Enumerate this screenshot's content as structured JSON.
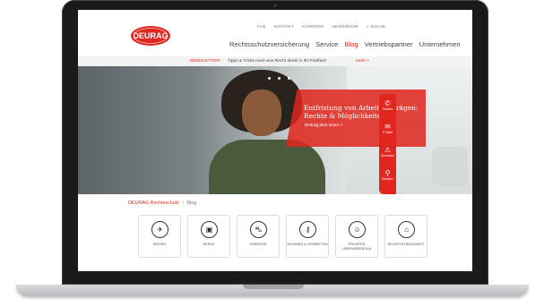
{
  "header": {
    "logo_text": "DEURAG",
    "top_nav": [
      "FAQ",
      "KONTAKT",
      "KARRIERE",
      "NEWSROOM"
    ],
    "search_label": "SUCHE",
    "main_nav": [
      {
        "label": "Rechtsschutzversicherung",
        "active": false
      },
      {
        "label": "Service",
        "active": false
      },
      {
        "label": "Blog",
        "active": true
      },
      {
        "label": "Vertriebspartner",
        "active": false
      },
      {
        "label": "Unternehmen",
        "active": false
      }
    ]
  },
  "newsletter": {
    "label": "NEWSLETTER:",
    "text": "Tipps & Tricks rund ums Recht direkt in Ihr Postfach",
    "more": "mehr >"
  },
  "hero": {
    "title": "Entfristung von Arbeitsverträgen: Rechte & Möglichkeiten",
    "cta": "Beitrag jetzt lesen  >"
  },
  "sidebar": {
    "items": [
      {
        "icon": "phone-icon",
        "glyph": "✆",
        "label": "Telefon"
      },
      {
        "icon": "mail-icon",
        "glyph": "✉",
        "label": "E-Mail"
      },
      {
        "icon": "warning-icon",
        "glyph": "⚠",
        "label": "Schaden"
      },
      {
        "icon": "location-icon",
        "glyph": "⚲",
        "label": "Berater"
      }
    ]
  },
  "breadcrumb": {
    "root": "DEURAG Rechtsschutz",
    "separator": "/",
    "current": "Blog"
  },
  "categories": [
    {
      "icon": "plane-icon",
      "glyph": "✈",
      "label": "REISEN"
    },
    {
      "icon": "briefcase-icon",
      "glyph": "▣",
      "label": "BERUF"
    },
    {
      "icon": "car-icon",
      "glyph": "⛍",
      "label": "VERKEHR"
    },
    {
      "icon": "key-icon",
      "glyph": "⚷",
      "label": "WOHNEN & VERMIETEN"
    },
    {
      "icon": "family-icon",
      "glyph": "☺",
      "label": "PRIVATER LEBENSBEREICH"
    },
    {
      "icon": "shop-icon",
      "glyph": "⌂",
      "label": "SELBSTSTÄNDIGKEIT"
    }
  ],
  "colors": {
    "brand_red": "#e0261d"
  }
}
